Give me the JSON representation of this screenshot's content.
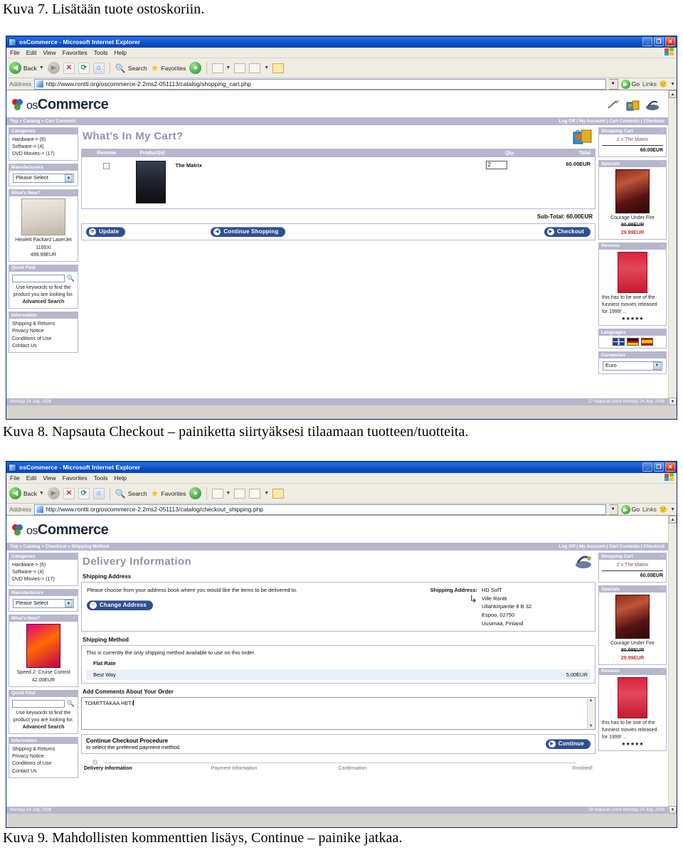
{
  "captions": {
    "kuva7": "Kuva 7. Lisätään tuote ostoskoriin.",
    "kuva8": "Kuva 8. Napsauta Checkout – painiketta siirtyäksesi tilaamaan tuotteen/tuotteita.",
    "kuva9": "Kuva 9. Mahdollisten kommenttien lisäys, Continue – painike jatkaa."
  },
  "browser": {
    "title": "osCommerce - Microsoft Internet Explorer",
    "menus": [
      "File",
      "Edit",
      "View",
      "Favorites",
      "Tools",
      "Help"
    ],
    "toolbar": {
      "back": "Back",
      "search": "Search",
      "favorites": "Favorites"
    },
    "address_label": "Address",
    "go_label": "Go",
    "links_label": "Links",
    "window_buttons": {
      "minimize": "_",
      "restore": "❐",
      "close": "✕"
    }
  },
  "urls": {
    "cart": "http://www.rontti.org/oscommerce-2.2ms2-051113/catalog/shopping_cart.php",
    "checkout": "http://www.rontti.org/oscommerce-2.2ms2-051113/catalog/checkout_shipping.php"
  },
  "store": {
    "logo_os": "os",
    "logo_commerce": "Commerce",
    "navlinks": "Log Off  |  My Account  |  Cart Contents  |  Checkout",
    "breadcrumb_cart": "Top » Catalog » Cart Contents",
    "breadcrumb_checkout": "Top » Catalog » Checkout » Shipping Method"
  },
  "sidebar_left": {
    "categories": {
      "title": "Categories",
      "items": [
        "Hardware-> (6)",
        "Software-> (4)",
        "DVD Movies-> (17)"
      ]
    },
    "manufacturers": {
      "title": "Manufacturers",
      "selected": "Please Select"
    },
    "whats_new": {
      "title": "What's New?",
      "minimize": "–"
    },
    "whats_new_cart": {
      "name": "Hewlett Packard LaserJet 1100Xi",
      "price": "499.99EUR"
    },
    "whats_new_checkout": {
      "name": "Speed 2: Cruise Control",
      "price": "42.00EUR"
    },
    "quick_find": {
      "title": "Quick Find",
      "search_value": "",
      "help": "Use keywords to find the product you are looking for.",
      "advanced": "Advanced Search"
    },
    "information": {
      "title": "Information",
      "items": [
        "Shipping & Returns",
        "Privacy Notice",
        "Conditions of Use",
        "Contact Us"
      ]
    }
  },
  "sidebar_right": {
    "shopping_cart": {
      "title": "Shopping Cart",
      "minimize": "–",
      "item": "2 x The Matrix",
      "total": "60.00EUR"
    },
    "specials": {
      "title": "Specials",
      "minimize": "–",
      "name": "Courage Under Fire",
      "old_price": "90.99EUR",
      "new_price": "29.99EUR"
    },
    "reviews": {
      "title": "Reviews",
      "minimize": "–",
      "text": "this has to be one of the funniest movies released for 1999! ..",
      "stars": "★★★★★"
    },
    "languages": {
      "title": "Languages",
      "flags": [
        "english-flag",
        "german-flag",
        "spanish-flag"
      ]
    },
    "currencies": {
      "title": "Currencies",
      "selected": "Euro"
    }
  },
  "cart_page": {
    "heading": "What's In My Cart?",
    "columns": [
      "Remove",
      "Product(s)",
      "Qty.",
      "Total"
    ],
    "rows": [
      {
        "remove_checked": false,
        "product": "The Matrix",
        "qty": "2",
        "total": "60.00EUR",
        "poster": "matrix-poster"
      }
    ],
    "subtotal": "Sub-Total: 60.00EUR",
    "buttons": {
      "update": "Update",
      "continue_shopping": "Continue Shopping",
      "checkout": "Checkout"
    }
  },
  "checkout_page": {
    "heading": "Delivery Information",
    "shipping_address_title": "Shipping Address",
    "shipping_address_help": "Please choose from your address book where you would like the items to be delivered to.",
    "change_address_button": "Change Address",
    "shipping_address_label": "Shipping Address:",
    "shipping_address_lines": [
      "HD SofT",
      "Ville Rontti",
      "Ullantorpantie 8 B 32",
      "Espoo, 02750",
      "Uusimaa, Finland"
    ],
    "shipping_method_title": "Shipping Method",
    "shipping_method_help": "This is currently the only shipping method available to use on this order.",
    "shipping_method_group": "Flat Rate",
    "shipping_method_option": "Best Way",
    "shipping_method_price": "5.00EUR",
    "comments_title": "Add Comments About Your Order",
    "comments_value": "TOIMITTAKAA HETI",
    "continue_title": "Continue Checkout Procedure",
    "continue_sub": "to select the preferred payment method.",
    "continue_button": "Continue",
    "progress": [
      "Delivery Information",
      "Payment Information",
      "Confirmation",
      "Finished!"
    ]
  },
  "footer": {
    "date": "Monday 24 July, 2006",
    "requests_cart": "27 requests since Monday 24 July, 2006",
    "requests_checkout": "28 requests since Monday 24 July, 2006"
  },
  "colors": {
    "accent_bar": "#b6b7cd",
    "button_blue": "#2f4f8f",
    "title_blue": "#0a47ad",
    "special_red": "#c0392b"
  }
}
